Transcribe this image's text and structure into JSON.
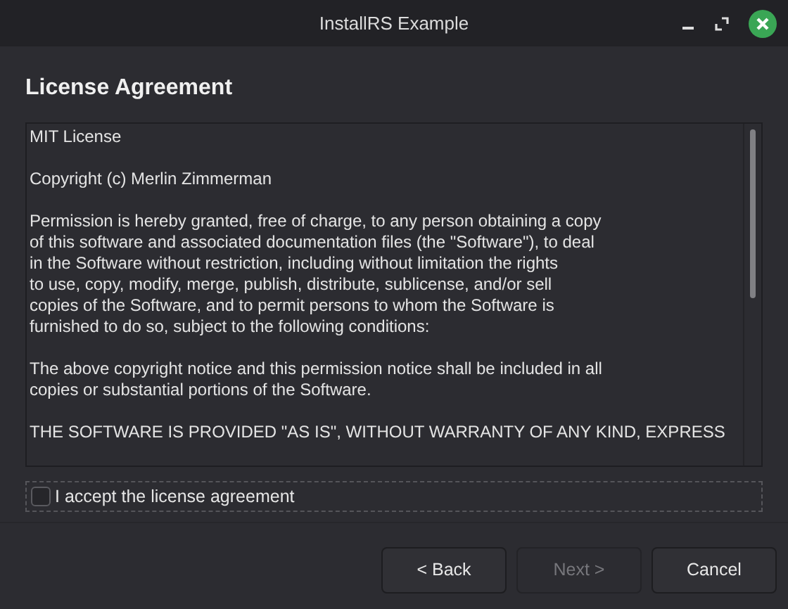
{
  "window": {
    "title": "InstallRS Example"
  },
  "heading": "License Agreement",
  "license": {
    "paragraphs": [
      "MIT License",
      "Copyright (c) Merlin Zimmerman",
      "Permission is hereby granted, free of charge, to any person obtaining a copy\nof this software and associated documentation files (the \"Software\"), to deal\nin the Software without restriction, including without limitation the rights\nto use, copy, modify, merge, publish, distribute, sublicense, and/or sell\ncopies of the Software, and to permit persons to whom the Software is\nfurnished to do so, subject to the following conditions:",
      "The above copyright notice and this permission notice shall be included in all\ncopies or substantial portions of the Software.",
      "THE SOFTWARE IS PROVIDED \"AS IS\", WITHOUT WARRANTY OF ANY KIND, EXPRESS"
    ]
  },
  "accept": {
    "label": "I accept the license agreement",
    "checked": false
  },
  "buttons": [
    {
      "label": "< Back",
      "disabled": false
    },
    {
      "label": "Next >",
      "disabled": true
    },
    {
      "label": "Cancel",
      "disabled": false
    }
  ]
}
